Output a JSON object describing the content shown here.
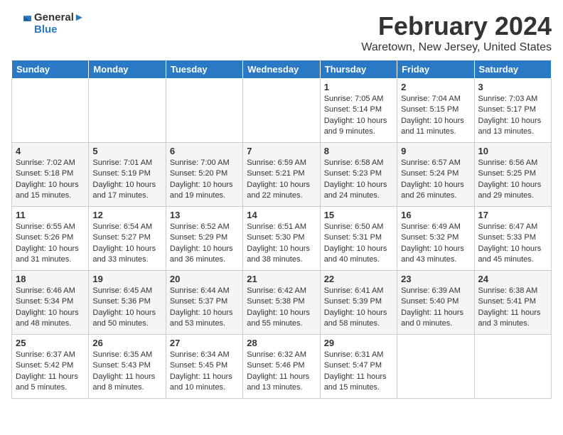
{
  "logo": {
    "line1": "General",
    "line2": "Blue"
  },
  "title": "February 2024",
  "subtitle": "Waretown, New Jersey, United States",
  "days_of_week": [
    "Sunday",
    "Monday",
    "Tuesday",
    "Wednesday",
    "Thursday",
    "Friday",
    "Saturday"
  ],
  "weeks": [
    [
      {
        "day": "",
        "info": ""
      },
      {
        "day": "",
        "info": ""
      },
      {
        "day": "",
        "info": ""
      },
      {
        "day": "",
        "info": ""
      },
      {
        "day": "1",
        "info": "Sunrise: 7:05 AM\nSunset: 5:14 PM\nDaylight: 10 hours\nand 9 minutes."
      },
      {
        "day": "2",
        "info": "Sunrise: 7:04 AM\nSunset: 5:15 PM\nDaylight: 10 hours\nand 11 minutes."
      },
      {
        "day": "3",
        "info": "Sunrise: 7:03 AM\nSunset: 5:17 PM\nDaylight: 10 hours\nand 13 minutes."
      }
    ],
    [
      {
        "day": "4",
        "info": "Sunrise: 7:02 AM\nSunset: 5:18 PM\nDaylight: 10 hours\nand 15 minutes."
      },
      {
        "day": "5",
        "info": "Sunrise: 7:01 AM\nSunset: 5:19 PM\nDaylight: 10 hours\nand 17 minutes."
      },
      {
        "day": "6",
        "info": "Sunrise: 7:00 AM\nSunset: 5:20 PM\nDaylight: 10 hours\nand 19 minutes."
      },
      {
        "day": "7",
        "info": "Sunrise: 6:59 AM\nSunset: 5:21 PM\nDaylight: 10 hours\nand 22 minutes."
      },
      {
        "day": "8",
        "info": "Sunrise: 6:58 AM\nSunset: 5:23 PM\nDaylight: 10 hours\nand 24 minutes."
      },
      {
        "day": "9",
        "info": "Sunrise: 6:57 AM\nSunset: 5:24 PM\nDaylight: 10 hours\nand 26 minutes."
      },
      {
        "day": "10",
        "info": "Sunrise: 6:56 AM\nSunset: 5:25 PM\nDaylight: 10 hours\nand 29 minutes."
      }
    ],
    [
      {
        "day": "11",
        "info": "Sunrise: 6:55 AM\nSunset: 5:26 PM\nDaylight: 10 hours\nand 31 minutes."
      },
      {
        "day": "12",
        "info": "Sunrise: 6:54 AM\nSunset: 5:27 PM\nDaylight: 10 hours\nand 33 minutes."
      },
      {
        "day": "13",
        "info": "Sunrise: 6:52 AM\nSunset: 5:29 PM\nDaylight: 10 hours\nand 36 minutes."
      },
      {
        "day": "14",
        "info": "Sunrise: 6:51 AM\nSunset: 5:30 PM\nDaylight: 10 hours\nand 38 minutes."
      },
      {
        "day": "15",
        "info": "Sunrise: 6:50 AM\nSunset: 5:31 PM\nDaylight: 10 hours\nand 40 minutes."
      },
      {
        "day": "16",
        "info": "Sunrise: 6:49 AM\nSunset: 5:32 PM\nDaylight: 10 hours\nand 43 minutes."
      },
      {
        "day": "17",
        "info": "Sunrise: 6:47 AM\nSunset: 5:33 PM\nDaylight: 10 hours\nand 45 minutes."
      }
    ],
    [
      {
        "day": "18",
        "info": "Sunrise: 6:46 AM\nSunset: 5:34 PM\nDaylight: 10 hours\nand 48 minutes."
      },
      {
        "day": "19",
        "info": "Sunrise: 6:45 AM\nSunset: 5:36 PM\nDaylight: 10 hours\nand 50 minutes."
      },
      {
        "day": "20",
        "info": "Sunrise: 6:44 AM\nSunset: 5:37 PM\nDaylight: 10 hours\nand 53 minutes."
      },
      {
        "day": "21",
        "info": "Sunrise: 6:42 AM\nSunset: 5:38 PM\nDaylight: 10 hours\nand 55 minutes."
      },
      {
        "day": "22",
        "info": "Sunrise: 6:41 AM\nSunset: 5:39 PM\nDaylight: 10 hours\nand 58 minutes."
      },
      {
        "day": "23",
        "info": "Sunrise: 6:39 AM\nSunset: 5:40 PM\nDaylight: 11 hours\nand 0 minutes."
      },
      {
        "day": "24",
        "info": "Sunrise: 6:38 AM\nSunset: 5:41 PM\nDaylight: 11 hours\nand 3 minutes."
      }
    ],
    [
      {
        "day": "25",
        "info": "Sunrise: 6:37 AM\nSunset: 5:42 PM\nDaylight: 11 hours\nand 5 minutes."
      },
      {
        "day": "26",
        "info": "Sunrise: 6:35 AM\nSunset: 5:43 PM\nDaylight: 11 hours\nand 8 minutes."
      },
      {
        "day": "27",
        "info": "Sunrise: 6:34 AM\nSunset: 5:45 PM\nDaylight: 11 hours\nand 10 minutes."
      },
      {
        "day": "28",
        "info": "Sunrise: 6:32 AM\nSunset: 5:46 PM\nDaylight: 11 hours\nand 13 minutes."
      },
      {
        "day": "29",
        "info": "Sunrise: 6:31 AM\nSunset: 5:47 PM\nDaylight: 11 hours\nand 15 minutes."
      },
      {
        "day": "",
        "info": ""
      },
      {
        "day": "",
        "info": ""
      }
    ]
  ],
  "colors": {
    "header_bg": "#2979c5",
    "header_text": "#ffffff",
    "row_even": "#f5f5f5",
    "row_odd": "#ffffff",
    "border": "#cccccc",
    "text": "#333333"
  }
}
